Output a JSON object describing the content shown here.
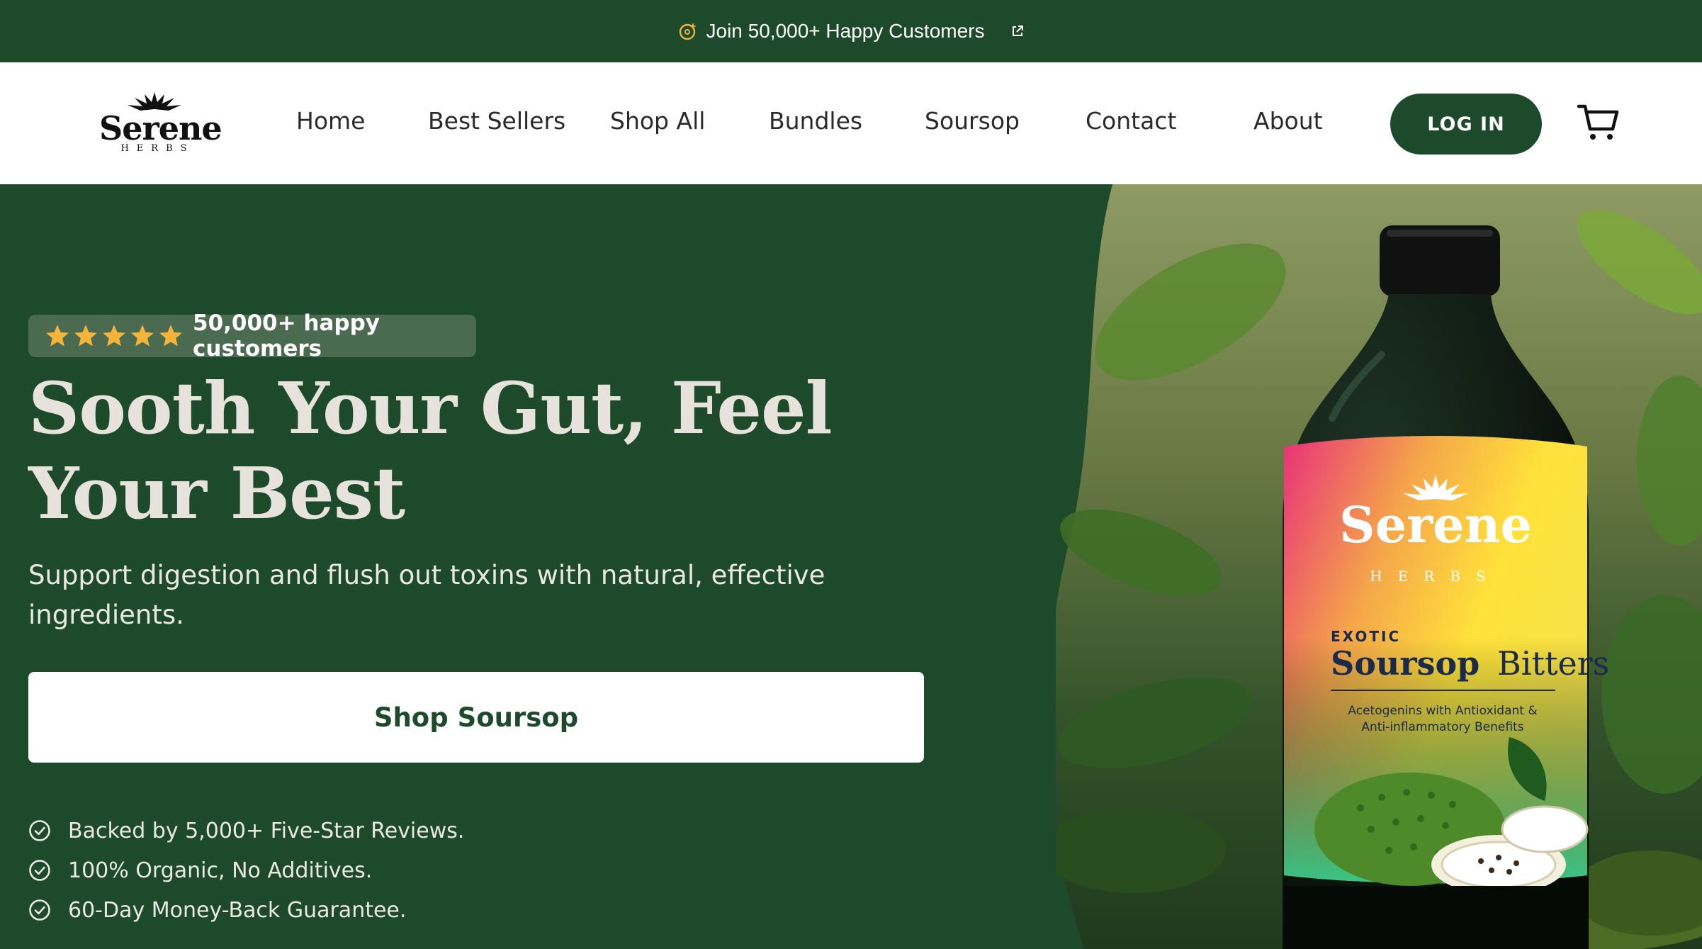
{
  "announcement": {
    "text": "Join 50,000+ Happy Customers"
  },
  "brand": {
    "name": "Serene",
    "subtitle": "HERBS"
  },
  "nav": {
    "items": [
      {
        "label": "Home"
      },
      {
        "label": "Best Sellers"
      },
      {
        "label": "Shop All"
      },
      {
        "label": "Bundles"
      },
      {
        "label": "Soursop"
      },
      {
        "label": "Contact"
      },
      {
        "label": "About"
      }
    ],
    "login_label": "LOG IN"
  },
  "hero": {
    "rating": {
      "stars": 5,
      "text": "50,000+ happy customers"
    },
    "headline_line1": "Sooth Your Gut, Feel",
    "headline_line2": "Your Best",
    "subhead": "Support digestion and flush out toxins with natural, effective ingredients.",
    "cta_label": "Shop Soursop",
    "benefits": [
      "Backed by 5,000+ Five-Star Reviews.",
      "100% Organic, No Additives.",
      "60-Day Money-Back Guarantee."
    ]
  },
  "product": {
    "brand": "Serene",
    "brand_sub": "HERBS",
    "kicker": "EXOTIC",
    "name_bold": "Soursop",
    "name_light": "Bitters",
    "claim_line1": "Acetogenins with Antioxidant &",
    "claim_line2": "Anti-inflammatory Benefits"
  },
  "colors": {
    "brand_green": "#1c4a2b",
    "star_gold": "#f4b43a",
    "cream": "#e7e3dc"
  },
  "icons": {
    "announcement": "sparkle-badge-icon",
    "external": "external-link-icon",
    "cart": "cart-icon",
    "check": "check-circle-icon",
    "star": "star-icon"
  }
}
